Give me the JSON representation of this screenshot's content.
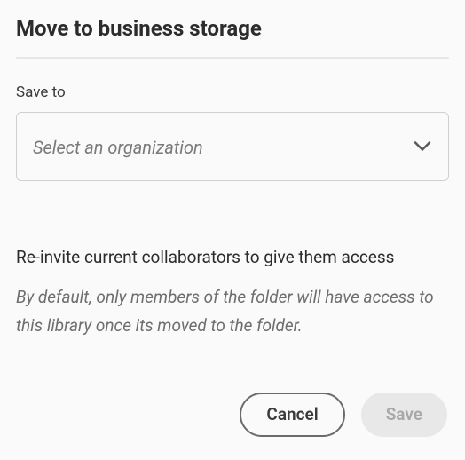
{
  "dialog": {
    "title": "Move to business storage",
    "saveto_label": "Save to",
    "org_select_placeholder": "Select an organization",
    "reinvite_heading": "Re-invite current collaborators to give them access",
    "helper_text": "By default, only members of the folder will have access to this library once its moved to the folder."
  },
  "buttons": {
    "cancel": "Cancel",
    "save": "Save"
  }
}
